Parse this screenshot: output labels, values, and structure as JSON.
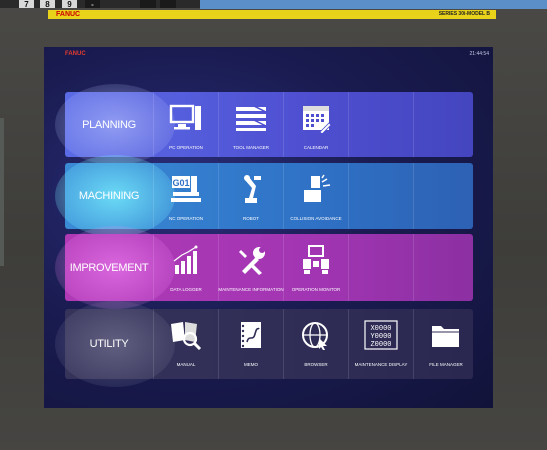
{
  "keypad": {
    "keys": [
      "7",
      "8",
      "9",
      "-",
      "",
      ""
    ]
  },
  "bezel": {
    "brand": "FANUC",
    "series": "SERIES 30i-MODEL B"
  },
  "screen": {
    "logo": "FANUC",
    "time": "21:44:54"
  },
  "rows": [
    {
      "category": "PLANNING",
      "items": [
        {
          "icon": "pc-monitor-icon",
          "label": "PC OPERATION"
        },
        {
          "icon": "tool-manager-icon",
          "label": "TOOL MANAGER"
        },
        {
          "icon": "calendar-icon",
          "label": "CALENDAR"
        }
      ]
    },
    {
      "category": "MACHINING",
      "items": [
        {
          "icon": "g01-nc-icon",
          "label": "NC OPERATION"
        },
        {
          "icon": "robot-arm-icon",
          "label": "ROBOT"
        },
        {
          "icon": "collision-icon",
          "label": "COLLISION AVOIDANCE"
        }
      ]
    },
    {
      "category": "IMPROVEMENT",
      "items": [
        {
          "icon": "chart-icon",
          "label": "DATA LOGGER"
        },
        {
          "icon": "wrench-icon",
          "label": "MAINTENANCE INFORMATION"
        },
        {
          "icon": "operation-monitor-icon",
          "label": "OPERATION MONITOR"
        }
      ]
    },
    {
      "category": "UTILITY",
      "items": [
        {
          "icon": "manual-book-icon",
          "label": "MANUAL"
        },
        {
          "icon": "memo-icon",
          "label": "MEMO"
        },
        {
          "icon": "browser-globe-icon",
          "label": "BROWSER"
        },
        {
          "icon": "maintenance-display-icon",
          "label": "MAINTENANCE DISPLAY"
        },
        {
          "icon": "folder-icon",
          "label": "FILE MANAGER"
        }
      ]
    }
  ]
}
